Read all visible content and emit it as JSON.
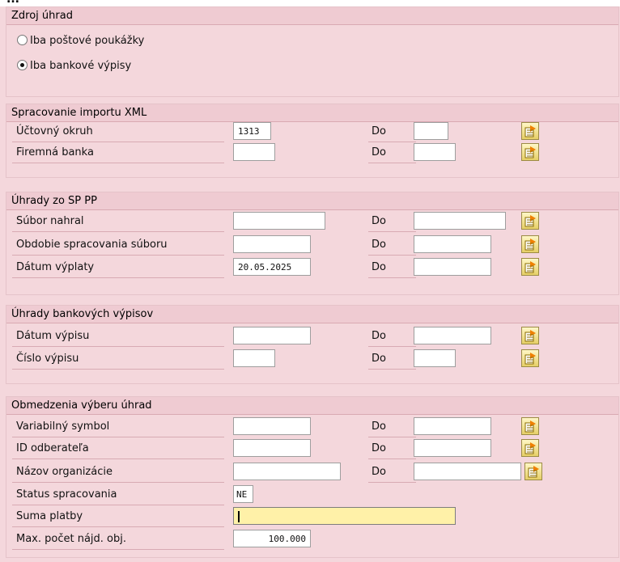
{
  "title_fragment": "...",
  "sections": {
    "zdroj": {
      "title": "Zdroj úhrad",
      "radio1": "Iba poštové poukážky",
      "radio2": "Iba bankové výpisy"
    },
    "xml": {
      "title": "Spracovanie importu XML",
      "okruh_label": "Účtovný okruh",
      "okruh_value": "1313",
      "banka_label": "Firemná banka"
    },
    "sp": {
      "title": "Úhrady zo SP PP",
      "subor_label": "Súbor nahral",
      "obdobie_label": "Obdobie spracovania súboru",
      "datum_label": "Dátum výplaty",
      "datum_value": "20.05.2025"
    },
    "vypisy": {
      "title": "Úhrady bankových výpisov",
      "datum_label": "Dátum výpisu",
      "cislo_label": "Číslo výpisu"
    },
    "obm": {
      "title": "Obmedzenia výberu úhrad",
      "var_label": "Variabilný symbol",
      "id_label": "ID odberateľa",
      "nazov_label": "Názov organizácie",
      "status_label": "Status spracovania",
      "status_value": "NE",
      "suma_label": "Suma platby",
      "max_label": "Max. počet nájd. obj.",
      "max_value": "100.000"
    }
  },
  "do_label": "Do",
  "icons": {
    "multiple_selection": "multiple-selection-arrow-icon"
  }
}
